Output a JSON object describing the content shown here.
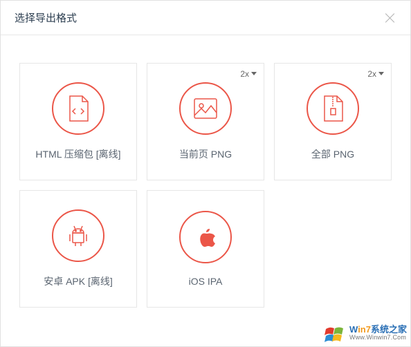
{
  "header": {
    "title": "选择导出格式"
  },
  "cards": [
    {
      "label": "HTML 压缩包 [离线]",
      "badge": null,
      "icon": "code-file"
    },
    {
      "label": "当前页 PNG",
      "badge": "2x",
      "icon": "image"
    },
    {
      "label": "全部 PNG",
      "badge": "2x",
      "icon": "zip"
    },
    {
      "label": "安卓 APK [离线]",
      "badge": null,
      "icon": "android"
    },
    {
      "label": "iOS IPA",
      "badge": null,
      "icon": "apple"
    }
  ],
  "watermark": {
    "brand_w": "W",
    "brand_n": "in7",
    "brand_rest": "系统之家",
    "url": "Www.Winwin7.Com"
  }
}
